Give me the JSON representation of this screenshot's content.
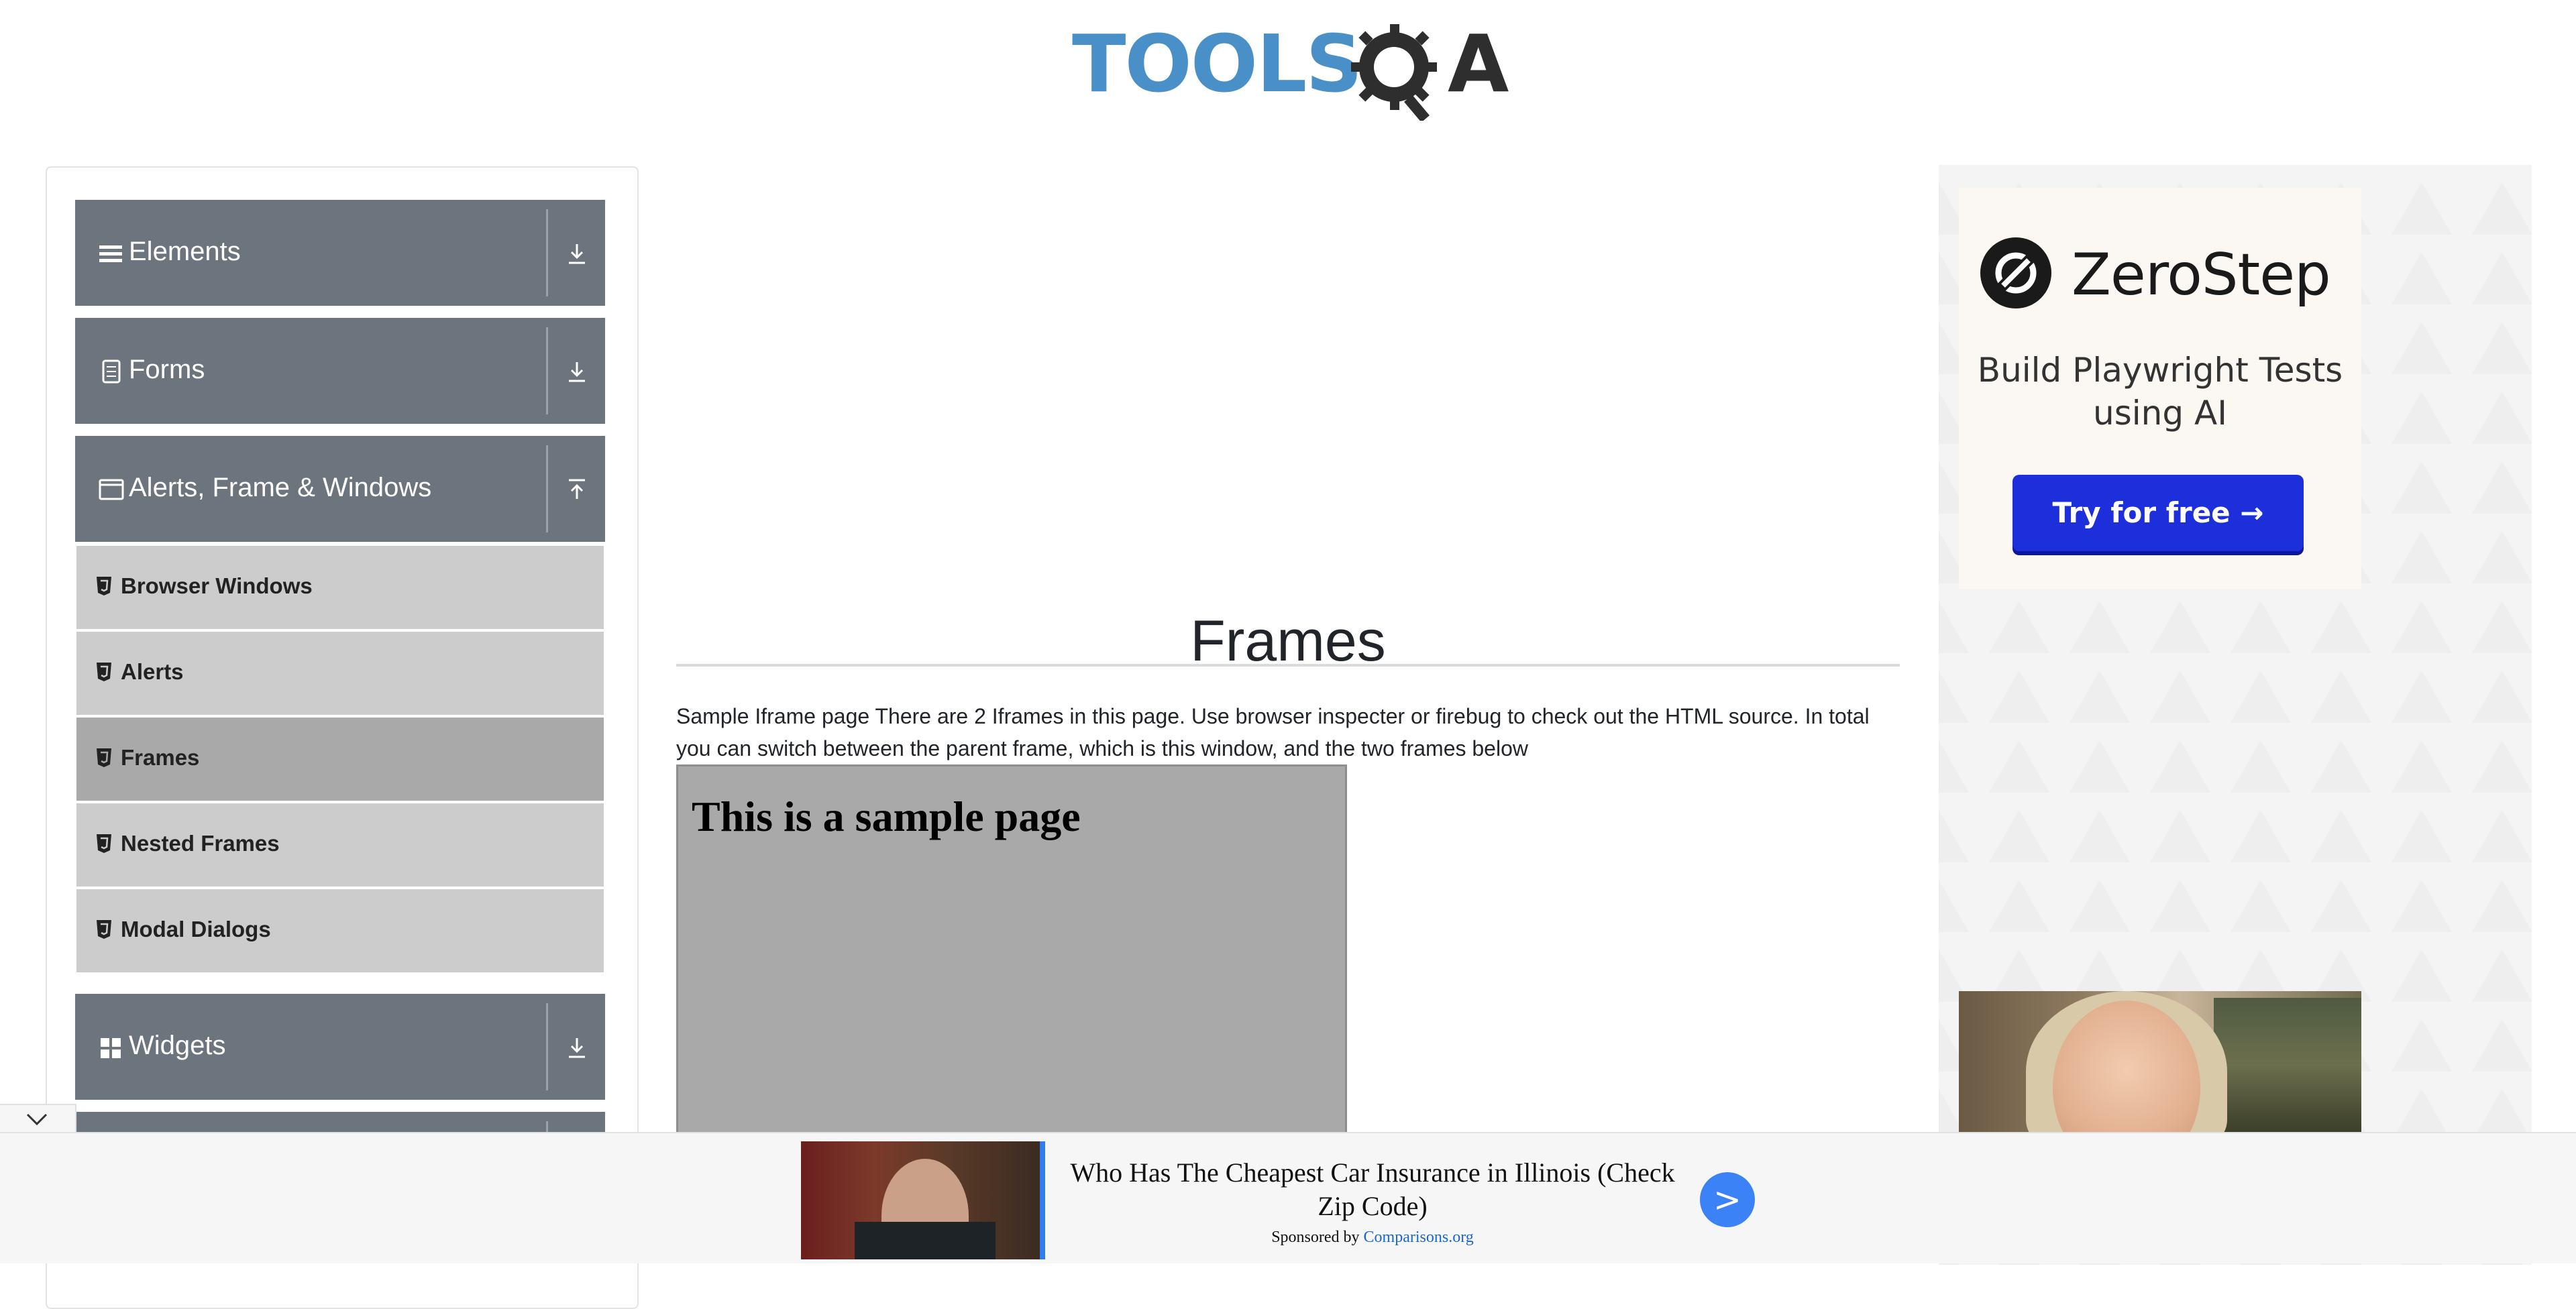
{
  "header": {
    "logo_text_left": "TOOLS",
    "logo_text_right": "A"
  },
  "sidebar": {
    "groups": [
      {
        "title": "Elements",
        "icon": "menu-icon",
        "expanded": false
      },
      {
        "title": "Forms",
        "icon": "document-icon",
        "expanded": false
      },
      {
        "title": "Alerts, Frame & Windows",
        "icon": "window-icon",
        "expanded": true,
        "items": [
          "Browser Windows",
          "Alerts",
          "Frames",
          "Nested Frames",
          "Modal Dialogs"
        ],
        "active_item": "Frames"
      },
      {
        "title": "Widgets",
        "icon": "grid-icon",
        "expanded": false
      }
    ]
  },
  "main": {
    "title": "Frames",
    "description": "Sample Iframe page There are 2 Iframes in this page. Use browser inspecter or firebug to check out the HTML source. In total you can switch between the parent frame, which is this window, and the two frames below",
    "iframe_heading": "This is a sample page"
  },
  "right_ad": {
    "brand": "ZeroStep",
    "tagline": "Build Playwright Tests using AI",
    "button_label": "Try for free →"
  },
  "bottom_ad": {
    "headline": "Who Has The Cheapest Car Insurance in Illinois (Check Zip Code)",
    "sponsor_prefix": "Sponsored by",
    "sponsor_name": "Comparisons.org",
    "arrow_label": ">"
  },
  "colors": {
    "sidebar_header": "#6c757d",
    "sidebar_item": "#cccccc",
    "sidebar_item_active": "#a9a9a9",
    "logo_blue": "#4a90c8",
    "cta_blue": "#1d2fdb",
    "ad_arrow_blue": "#3b82f6"
  }
}
